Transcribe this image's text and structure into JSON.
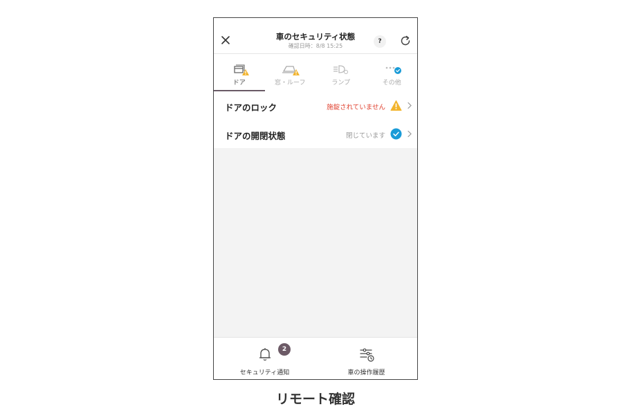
{
  "header": {
    "title": "車のセキュリティ状態",
    "subtitle": "確認日時：8/8 15:25",
    "help_label": "?",
    "icons": {
      "close": "close-icon",
      "refresh": "refresh-icon"
    }
  },
  "tabs": [
    {
      "label": "ドア",
      "icon": "car-door-icon",
      "status": "warning",
      "active": true
    },
    {
      "label": "窓・ルーフ",
      "icon": "car-window-icon",
      "status": "warning",
      "active": false
    },
    {
      "label": "ランプ",
      "icon": "car-lamp-icon",
      "status": "none",
      "active": false
    },
    {
      "label": "その他",
      "icon": "more-icon",
      "status": "ok",
      "active": false
    }
  ],
  "rows": [
    {
      "label": "ドアのロック",
      "status": "施錠されていません",
      "status_type": "warning"
    },
    {
      "label": "ドアの開閉状態",
      "status": "閉じています",
      "status_type": "ok"
    }
  ],
  "bottom_nav": [
    {
      "label": "セキュリティ通知",
      "icon": "bell-icon",
      "badge": "2"
    },
    {
      "label": "車の操作履歴",
      "icon": "history-icon"
    }
  ],
  "caption": "リモート確認",
  "colors": {
    "warning_icon": "#f2b42d",
    "warning_text": "#e0412f",
    "ok_icon": "#1a9bd7",
    "tab_indicator": "#6a5a66",
    "badge": "#6c5a66"
  }
}
